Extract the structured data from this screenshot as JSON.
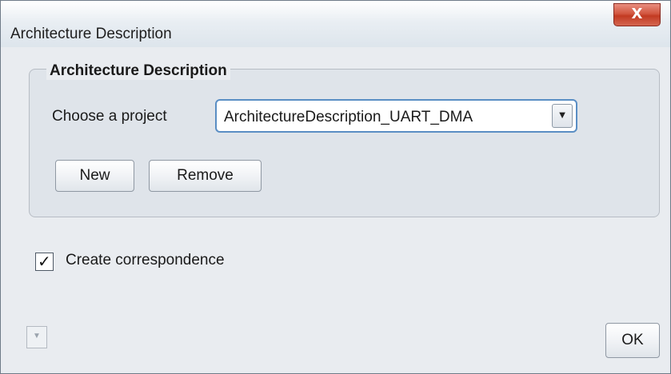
{
  "window": {
    "title": "Architecture Description",
    "close_label": "X"
  },
  "group": {
    "title": "Architecture Description",
    "project_label": "Choose a project",
    "project_value": "ArchitectureDescription_UART_DMA",
    "dropdown_arrow_icon": "triangle-down",
    "new_label": "New",
    "remove_label": "Remove"
  },
  "options": {
    "create_correspondence_label": "Create correspondence",
    "create_correspondence_checked": true,
    "checkmark": "✓"
  },
  "footer": {
    "small_dropdown_icon": "triangle-down",
    "ok_label": "OK"
  }
}
